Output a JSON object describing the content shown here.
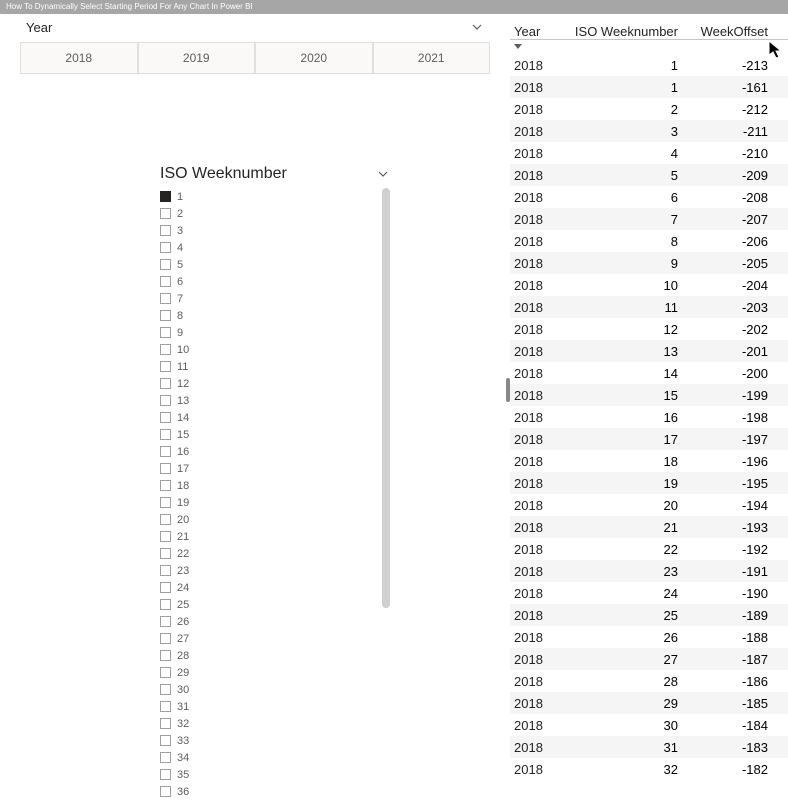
{
  "videoTitle": "How To Dynamically Select Starting Period For Any Chart In Power BI",
  "yearSlicer": {
    "title": "Year",
    "options": [
      "2018",
      "2019",
      "2020",
      "2021"
    ]
  },
  "weekSlicer": {
    "title": "ISO Weeknumber",
    "selected": [
      1
    ],
    "items": [
      1,
      2,
      3,
      4,
      5,
      6,
      7,
      8,
      9,
      10,
      11,
      12,
      13,
      14,
      15,
      16,
      17,
      18,
      19,
      20,
      21,
      22,
      23,
      24,
      25,
      26,
      27,
      28,
      29,
      30,
      31,
      32,
      33,
      34,
      35,
      36
    ]
  },
  "table": {
    "columns": [
      "Year",
      "ISO Weeknumber",
      "WeekOffset"
    ],
    "rows": [
      {
        "year": "2018",
        "wk": 1,
        "off": -213
      },
      {
        "year": "2018",
        "wk": 1,
        "off": -161
      },
      {
        "year": "2018",
        "wk": 2,
        "off": -212
      },
      {
        "year": "2018",
        "wk": 3,
        "off": -211
      },
      {
        "year": "2018",
        "wk": 4,
        "off": -210
      },
      {
        "year": "2018",
        "wk": 5,
        "off": -209
      },
      {
        "year": "2018",
        "wk": 6,
        "off": -208
      },
      {
        "year": "2018",
        "wk": 7,
        "off": -207
      },
      {
        "year": "2018",
        "wk": 8,
        "off": -206
      },
      {
        "year": "2018",
        "wk": 9,
        "off": -205
      },
      {
        "year": "2018",
        "wk": 10,
        "off": -204
      },
      {
        "year": "2018",
        "wk": 11,
        "off": -203
      },
      {
        "year": "2018",
        "wk": 12,
        "off": -202
      },
      {
        "year": "2018",
        "wk": 13,
        "off": -201
      },
      {
        "year": "2018",
        "wk": 14,
        "off": -200
      },
      {
        "year": "2018",
        "wk": 15,
        "off": -199
      },
      {
        "year": "2018",
        "wk": 16,
        "off": -198
      },
      {
        "year": "2018",
        "wk": 17,
        "off": -197
      },
      {
        "year": "2018",
        "wk": 18,
        "off": -196
      },
      {
        "year": "2018",
        "wk": 19,
        "off": -195
      },
      {
        "year": "2018",
        "wk": 20,
        "off": -194
      },
      {
        "year": "2018",
        "wk": 21,
        "off": -193
      },
      {
        "year": "2018",
        "wk": 22,
        "off": -192
      },
      {
        "year": "2018",
        "wk": 23,
        "off": -191
      },
      {
        "year": "2018",
        "wk": 24,
        "off": -190
      },
      {
        "year": "2018",
        "wk": 25,
        "off": -189
      },
      {
        "year": "2018",
        "wk": 26,
        "off": -188
      },
      {
        "year": "2018",
        "wk": 27,
        "off": -187
      },
      {
        "year": "2018",
        "wk": 28,
        "off": -186
      },
      {
        "year": "2018",
        "wk": 29,
        "off": -185
      },
      {
        "year": "2018",
        "wk": 30,
        "off": -184
      },
      {
        "year": "2018",
        "wk": 31,
        "off": -183
      },
      {
        "year": "2018",
        "wk": 32,
        "off": -182
      }
    ]
  }
}
